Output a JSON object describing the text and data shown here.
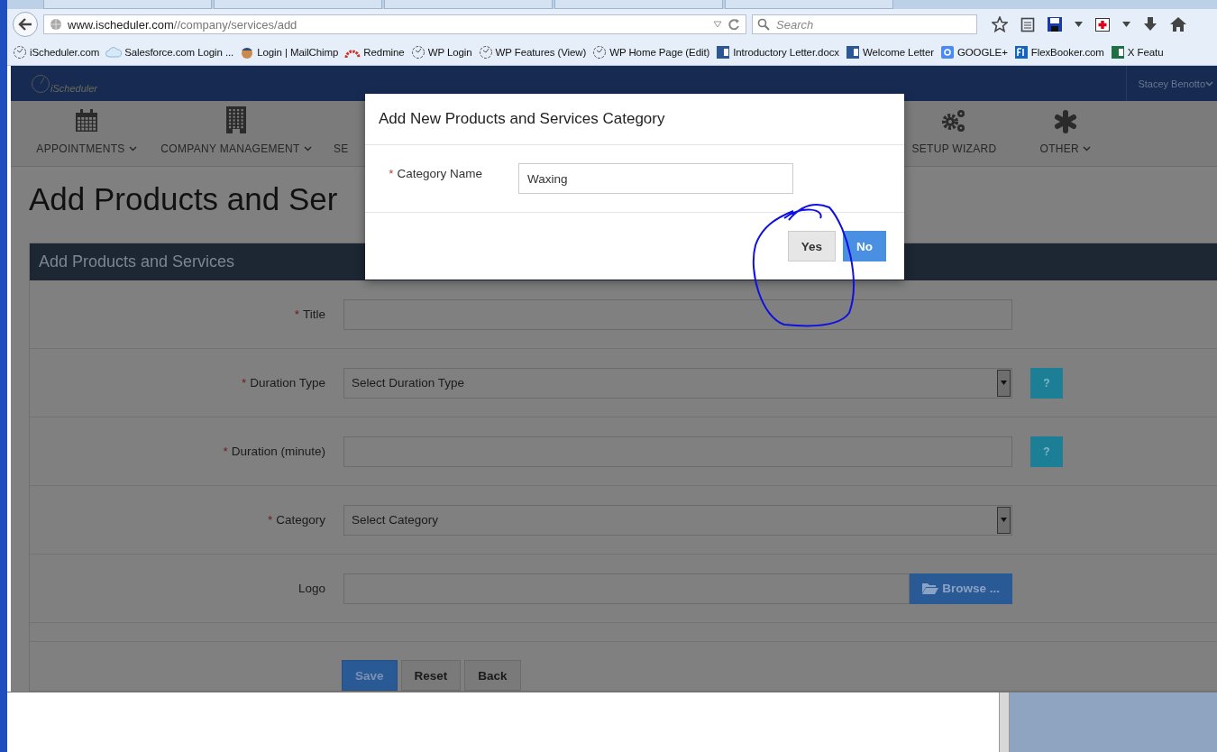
{
  "browser": {
    "url_host": "www.ischeduler.com",
    "url_path": "//company/services/add",
    "search_placeholder": "Search",
    "bookmarks": [
      {
        "label": "iScheduler.com",
        "kind": "clock"
      },
      {
        "label": "Salesforce.com Login ...",
        "kind": "cloud"
      },
      {
        "label": "Login | MailChimp",
        "kind": "chimp"
      },
      {
        "label": "Redmine",
        "kind": "redmine"
      },
      {
        "label": "WP Login",
        "kind": "clock"
      },
      {
        "label": "WP Features (View)",
        "kind": "clock"
      },
      {
        "label": "WP Home Page (Edit)",
        "kind": "clock"
      },
      {
        "label": "Introductory Letter.docx",
        "kind": "word"
      },
      {
        "label": "Welcome Letter",
        "kind": "word"
      },
      {
        "label": "GOOGLE+",
        "kind": "google"
      },
      {
        "label": "FlexBooker.com",
        "kind": "flexbooker"
      },
      {
        "label": "X Featu",
        "kind": "excel"
      }
    ]
  },
  "header": {
    "logo": "iScheduler",
    "user": "Stacey Benotto"
  },
  "nav": [
    {
      "label": "APPOINTMENTS",
      "kind": "calendar",
      "dropdown": true
    },
    {
      "label": "COMPANY MANAGEMENT",
      "kind": "building",
      "dropdown": true
    },
    {
      "label": "SE",
      "kind": "hidden",
      "dropdown": false
    },
    {
      "label": "SETUP WIZARD",
      "kind": "gears",
      "dropdown": false
    },
    {
      "label": "OTHER",
      "kind": "asterisk",
      "dropdown": true
    }
  ],
  "page_title": "Add Products and Ser",
  "panel": {
    "title": "Add Products and Services",
    "fields": [
      {
        "label": "Title",
        "required_mark": "*",
        "kind": "text"
      },
      {
        "label": "Duration Type",
        "required_mark": "*",
        "kind": "select",
        "value": "Select Duration Type",
        "help": "?"
      },
      {
        "label": "Duration (minute)",
        "required_mark": "*",
        "kind": "text",
        "help": "?"
      },
      {
        "label": "Category",
        "required_mark": "*",
        "kind": "select",
        "value": "Select Category"
      },
      {
        "label": "Logo",
        "kind": "file",
        "button": "Browse ..."
      }
    ],
    "buttons": [
      {
        "label": "Save",
        "kind": "primary"
      },
      {
        "label": "Reset",
        "kind": "default"
      },
      {
        "label": "Back",
        "kind": "default"
      }
    ]
  },
  "modal": {
    "title": "Add New Products and Services Category",
    "field_label": "Category Name",
    "required_mark": "*",
    "value": "Waxing",
    "buttons": [
      {
        "label": "Yes",
        "kind": "default"
      },
      {
        "label": "No",
        "kind": "primary"
      }
    ]
  }
}
